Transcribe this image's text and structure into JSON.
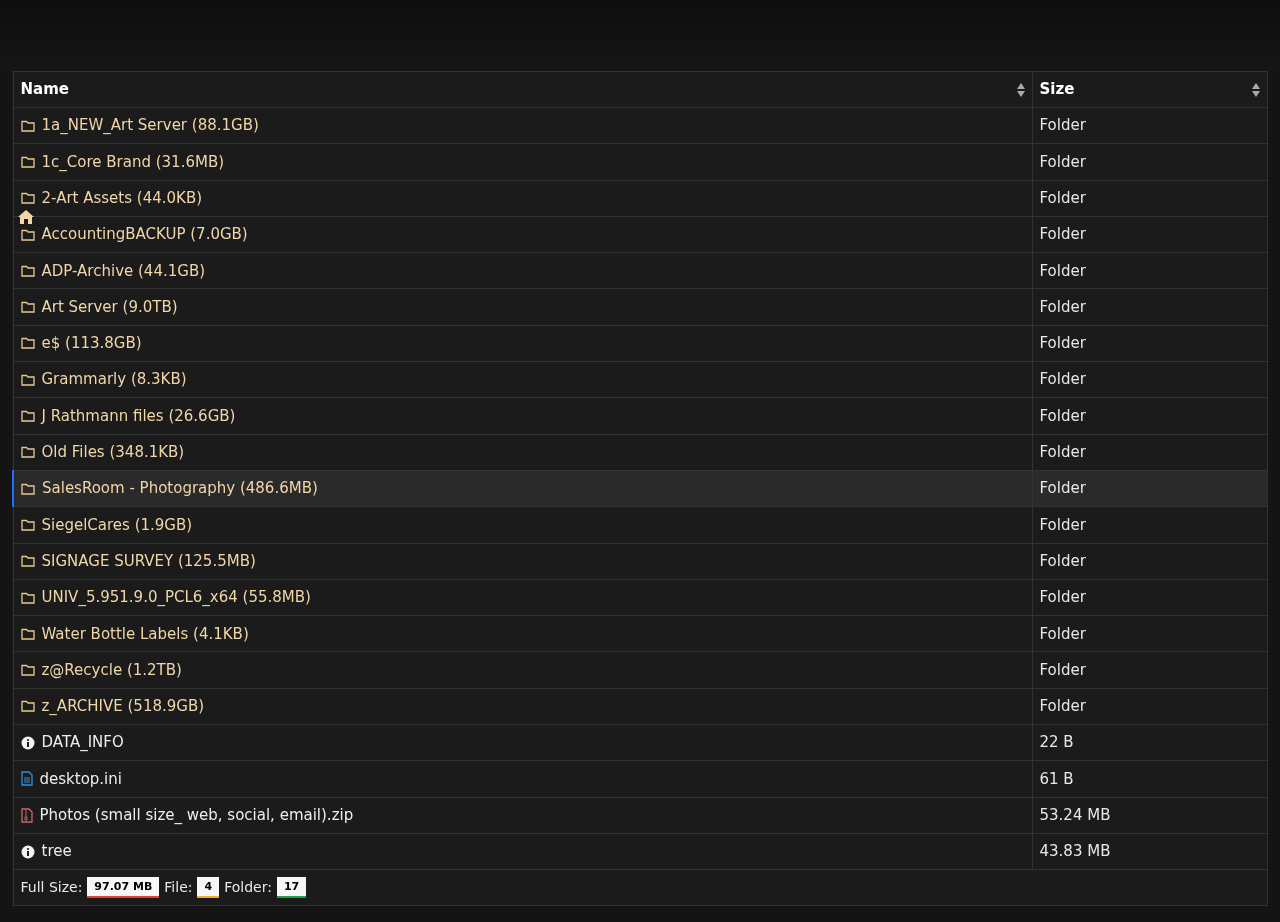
{
  "table": {
    "columns": [
      "Name",
      "Size"
    ],
    "rows": [
      {
        "kind": "folder",
        "name": "1a_NEW_Art Server (88.1GB)",
        "size": "Folder",
        "selected": false
      },
      {
        "kind": "folder",
        "name": "1c_Core Brand (31.6MB)",
        "size": "Folder",
        "selected": false
      },
      {
        "kind": "folder",
        "name": "2-Art Assets (44.0KB)",
        "size": "Folder",
        "selected": false
      },
      {
        "kind": "folder",
        "name": "AccountingBACKUP (7.0GB)",
        "size": "Folder",
        "selected": false
      },
      {
        "kind": "folder",
        "name": "ADP-Archive (44.1GB)",
        "size": "Folder",
        "selected": false
      },
      {
        "kind": "folder",
        "name": "Art Server (9.0TB)",
        "size": "Folder",
        "selected": false
      },
      {
        "kind": "folder",
        "name": "e$ (113.8GB)",
        "size": "Folder",
        "selected": false
      },
      {
        "kind": "folder",
        "name": "Grammarly (8.3KB)",
        "size": "Folder",
        "selected": false
      },
      {
        "kind": "folder",
        "name": "J Rathmann files (26.6GB)",
        "size": "Folder",
        "selected": false
      },
      {
        "kind": "folder",
        "name": "Old Files (348.1KB)",
        "size": "Folder",
        "selected": false
      },
      {
        "kind": "folder",
        "name": "SalesRoom - Photography (486.6MB)",
        "size": "Folder",
        "selected": true
      },
      {
        "kind": "folder",
        "name": "SiegelCares (1.9GB)",
        "size": "Folder",
        "selected": false
      },
      {
        "kind": "folder",
        "name": "SIGNAGE SURVEY (125.5MB)",
        "size": "Folder",
        "selected": false
      },
      {
        "kind": "folder",
        "name": "UNIV_5.951.9.0_PCL6_x64 (55.8MB)",
        "size": "Folder",
        "selected": false
      },
      {
        "kind": "folder",
        "name": "Water Bottle Labels (4.1KB)",
        "size": "Folder",
        "selected": false
      },
      {
        "kind": "folder",
        "name": "z@Recycle (1.2TB)",
        "size": "Folder",
        "selected": false
      },
      {
        "kind": "folder",
        "name": "z_ARCHIVE (518.9GB)",
        "size": "Folder",
        "selected": false
      },
      {
        "kind": "info",
        "name": "DATA_INFO",
        "size": "22 B",
        "selected": false
      },
      {
        "kind": "text",
        "name": "desktop.ini",
        "size": "61 B",
        "selected": false
      },
      {
        "kind": "archive",
        "name": "Photos (small size_ web, social, email).zip",
        "size": "53.24 MB",
        "selected": false
      },
      {
        "kind": "info",
        "name": "tree",
        "size": "43.83 MB",
        "selected": false
      }
    ]
  },
  "footer": [
    {
      "label": "Full Size:",
      "value": "97.07 MB",
      "color": "#e0442f"
    },
    {
      "label": "File:",
      "value": "4",
      "color": "#f2b01e"
    },
    {
      "label": "Folder:",
      "value": "17",
      "color": "#1aa34a"
    }
  ]
}
